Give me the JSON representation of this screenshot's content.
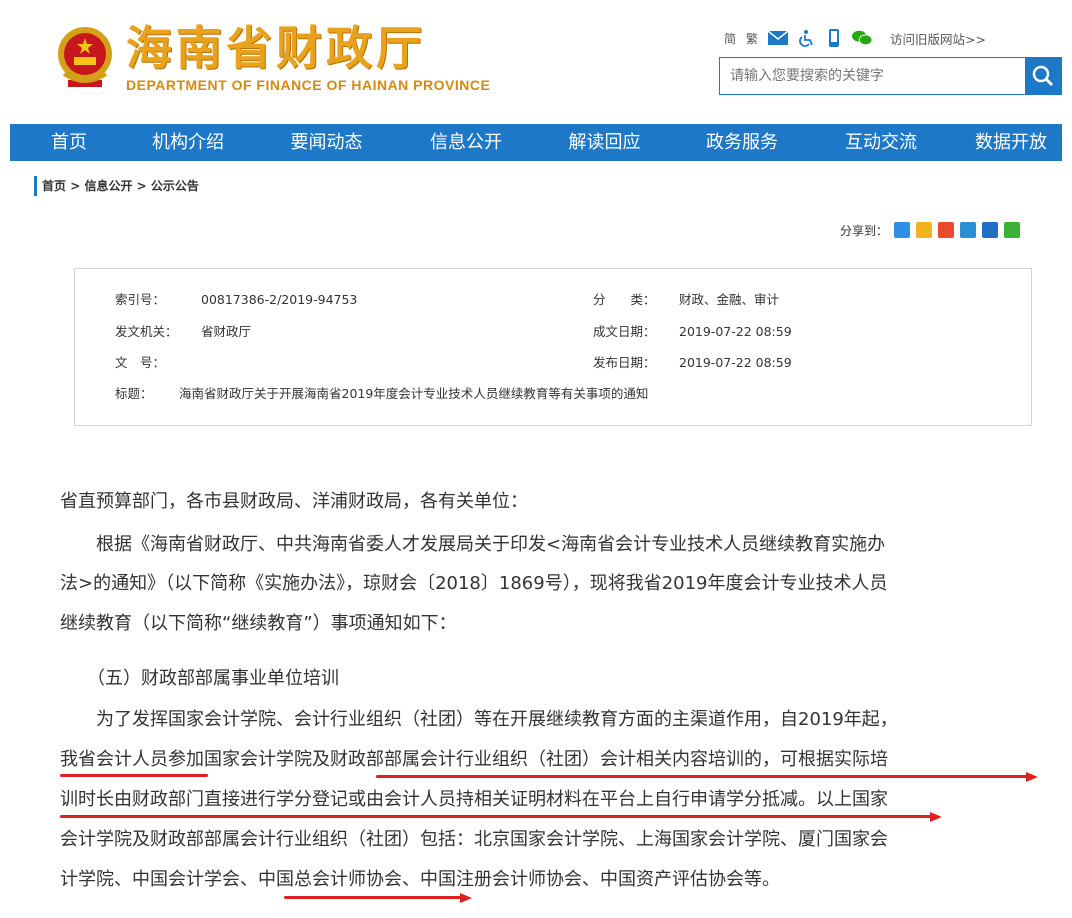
{
  "header": {
    "logo_cn": "海南省财政厅",
    "logo_en": "DEPARTMENT OF FINANCE OF HAINAN PROVINCE",
    "toplinks": {
      "simplified": "简",
      "traditional": "繁",
      "old_site": "访问旧版网站>>"
    },
    "search": {
      "placeholder": "请输入您要搜索的关键字"
    }
  },
  "nav": [
    "首页",
    "机构介绍",
    "要闻动态",
    "信息公开",
    "解读回应",
    "政务服务",
    "互动交流",
    "数据开放"
  ],
  "breadcrumb": {
    "home": "首页",
    "sep": " > ",
    "level1": "信息公开",
    "level2": "公示公告"
  },
  "share": {
    "label": "分享到："
  },
  "info": {
    "index_label": "索引号：",
    "index_value": "00817386-2/2019-94753",
    "category_label": "分　　类：",
    "category_value": "财政、金融、审计",
    "issuer_label": "发文机关：",
    "issuer_value": "省财政厅",
    "created_label": "成文日期：",
    "created_value": "2019-07-22 08:59",
    "docno_label": "文　号：",
    "docno_value": "",
    "published_label": "发布日期：",
    "published_value": "2019-07-22 08:59",
    "title_label": "标题：",
    "title_value": "海南省财政厅关于开展海南省2019年度会计专业技术人员继续教育等有关事项的通知"
  },
  "article": {
    "lines": [
      "省直预算部门，各市县财政局、洋浦财政局，各有关单位：",
      "　　根据《海南省财政厅、中共海南省委人才发展局关于印发<海南省会计专业技术人员继续教育实施办",
      "法>的通知》（以下简称《实施办法》，琼财会〔2018〕1869号），现将我省2019年度会计专业技术人员",
      "继续教育（以下简称“继续教育”）事项通知如下：",
      "　　（五）财政部部属事业单位培训",
      "　　为了发挥国家会计学院、会计行业组织（社团）等在开展继续教育方面的主渠道作用，自2019年起，",
      "我省会计人员参加国家会计学院及财政部部属会计行业组织（社团）会计相关内容培训的，可根据实际培",
      "训时长由财政部门直接进行学分登记或由会计人员持相关证明材料在平台上自行申请学分抵减。以上国家",
      "会计学院及财政部部属会计行业组织（社团）包括：北京国家会计学院、上海国家会计学院、厦门国家会",
      "计学院、中国会计学会、中国总会计师协会、中国注册会计师协会、中国资产评估协会等。"
    ]
  },
  "colors": {
    "nav_blue": "#1e78c8",
    "logo_gold": "#e9a21b",
    "underline_red": "#e02020"
  }
}
